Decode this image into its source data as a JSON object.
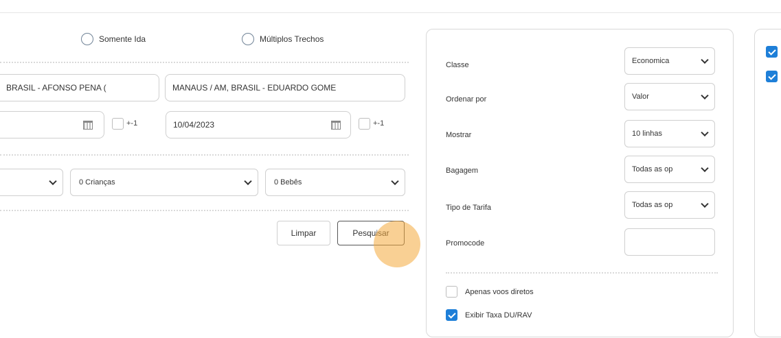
{
  "trip_type": {
    "one_way_label": "Somente Ida",
    "multi_label": "Múltiplos Trechos"
  },
  "route": {
    "origin_value": "BRASIL - AFONSO PENA (",
    "destination_value": "MANAUS / AM, BRASIL - EDUARDO GOME"
  },
  "dates": {
    "depart_value": "",
    "return_value": "10/04/2023",
    "flex_label": "+-1"
  },
  "passengers": {
    "adults_value": "",
    "children_value": "0 Crianças",
    "infants_value": "0 Bebês"
  },
  "actions": {
    "clear_label": "Limpar",
    "search_label": "Pesquisar"
  },
  "filters": {
    "class_label": "Classe",
    "class_value": "Economica",
    "sort_label": "Ordenar por",
    "sort_value": "Valor",
    "show_label": "Mostrar",
    "show_value": "10 linhas",
    "baggage_label": "Bagagem",
    "baggage_value": "Todas as op",
    "fare_label": "Tipo de Tarifa",
    "fare_value": "Todas as op",
    "promo_label": "Promocode",
    "promo_value": "",
    "direct_label": "Apenas voos diretos",
    "direct_checked": false,
    "du_label": "Exibir Taxa DU/RAV",
    "du_checked": true
  },
  "right_panel": {
    "check1": true,
    "check2": true
  },
  "colors": {
    "accent": "#1e7fd8",
    "cursor": "#f4aa3c"
  }
}
